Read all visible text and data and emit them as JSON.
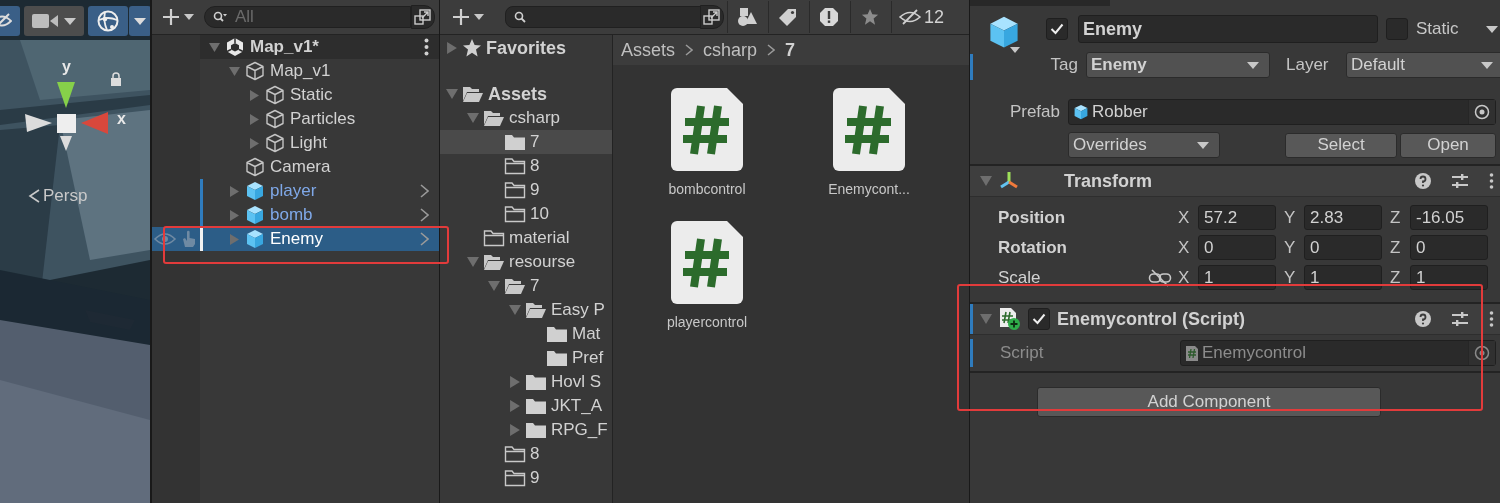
{
  "scene_view": {
    "toolbar": [
      {
        "kind": "visibility",
        "on": true
      },
      {
        "kind": "camera",
        "on": false
      },
      {
        "kind": "gizmos",
        "on": true
      }
    ],
    "gizmo": {
      "axis_labels": [
        "y",
        "x"
      ]
    },
    "projection": "Persp"
  },
  "hierarchy": {
    "search": {
      "placeholder": "All"
    },
    "items": [
      {
        "label": "Map_v1*",
        "kind": "scene",
        "expanded": true,
        "selected": false,
        "hovered": false,
        "highlighted": false,
        "children": [
          {
            "label": "Map_v1",
            "kind": "object",
            "expanded": true,
            "selected": false,
            "hovered": false,
            "highlighted": false,
            "children": [
              {
                "label": "Static",
                "kind": "object",
                "expanded": false,
                "selected": false,
                "hovered": false,
                "highlighted": false
              },
              {
                "label": "Particles",
                "kind": "object",
                "expanded": false,
                "selected": false,
                "hovered": false,
                "highlighted": false
              },
              {
                "label": "Light",
                "kind": "object",
                "expanded": false,
                "selected": false,
                "hovered": false,
                "highlighted": false
              }
            ]
          },
          {
            "label": "Camera",
            "kind": "object",
            "selected": false,
            "hovered": false,
            "highlighted": false
          },
          {
            "label": "player",
            "kind": "prefab",
            "expanded": false,
            "selected": false,
            "hovered": false,
            "highlighted": false
          },
          {
            "label": "bomb",
            "kind": "prefab",
            "expanded": false,
            "selected": false,
            "hovered": false,
            "highlighted": false
          },
          {
            "label": "Enemy",
            "kind": "prefab",
            "expanded": false,
            "selected": true,
            "hovered": true,
            "highlighted": true
          }
        ]
      }
    ]
  },
  "project": {
    "hidden_count": "12",
    "tree": [
      {
        "label": "Favorites",
        "kind": "favorites",
        "expanded": false,
        "selected": false
      },
      {
        "label": "Assets",
        "kind": "folder",
        "expanded": true,
        "selected": false,
        "children": [
          {
            "label": "csharp",
            "kind": "folder",
            "expanded": true,
            "selected": false,
            "children": [
              {
                "label": "7",
                "kind": "folder",
                "empty": false,
                "selected": true
              },
              {
                "label": "8",
                "kind": "folder",
                "empty": true,
                "selected": false
              },
              {
                "label": "9",
                "kind": "folder",
                "empty": true,
                "selected": false
              },
              {
                "label": "10",
                "kind": "folder",
                "empty": true,
                "selected": false
              }
            ]
          },
          {
            "label": "material",
            "kind": "folder",
            "empty": true,
            "selected": false
          },
          {
            "label": "resourse",
            "kind": "folder",
            "expanded": true,
            "selected": false,
            "children": [
              {
                "label": "7",
                "kind": "folder",
                "expanded": true,
                "selected": false,
                "children": [
                  {
                    "label": "Easy P",
                    "kind": "folder",
                    "expanded": true,
                    "selected": false,
                    "children": [
                      {
                        "label": "Mat",
                        "kind": "folder",
                        "empty": false,
                        "selected": false
                      },
                      {
                        "label": "Pref",
                        "kind": "folder",
                        "empty": false,
                        "selected": false
                      }
                    ]
                  },
                  {
                    "label": "Hovl S",
                    "kind": "folder",
                    "expanded": false,
                    "selected": false
                  },
                  {
                    "label": "JKT_A",
                    "kind": "folder",
                    "expanded": false,
                    "selected": false
                  },
                  {
                    "label": "RPG_F",
                    "kind": "folder",
                    "expanded": false,
                    "selected": false
                  }
                ]
              },
              {
                "label": "8",
                "kind": "folder",
                "empty": true,
                "selected": false
              },
              {
                "label": "9",
                "kind": "folder",
                "empty": true,
                "selected": false
              }
            ]
          }
        ]
      }
    ],
    "breadcrumb": [
      "Assets",
      "csharp",
      "7"
    ],
    "files": [
      {
        "name": "bombcontrol",
        "kind": "script"
      },
      {
        "name": "Enemycont...",
        "kind": "script"
      },
      {
        "name": "playercontrol",
        "kind": "script"
      }
    ]
  },
  "inspector": {
    "object": {
      "active": true,
      "name": "Enemy",
      "static": false,
      "static_label": "Static"
    },
    "tag": {
      "label": "Tag",
      "value": "Enemy"
    },
    "layer": {
      "label": "Layer",
      "value": "Default"
    },
    "prefab": {
      "label": "Prefab",
      "asset": "Robber",
      "overrides": "Overrides",
      "buttons": [
        "Select",
        "Open"
      ]
    },
    "components": [
      {
        "kind": "transform",
        "title": "Transform",
        "expanded": true,
        "added": false,
        "highlighted": false,
        "rows": [
          {
            "label": "Position",
            "overridden": true,
            "values": [
              {
                "axis": "X",
                "value": "57.2"
              },
              {
                "axis": "Y",
                "value": "2.83"
              },
              {
                "axis": "Z",
                "value": "-16.05"
              }
            ]
          },
          {
            "label": "Rotation",
            "overridden": true,
            "values": [
              {
                "axis": "X",
                "value": "0"
              },
              {
                "axis": "Y",
                "value": "0"
              },
              {
                "axis": "Z",
                "value": "0"
              }
            ]
          },
          {
            "label": "Scale",
            "overridden": false,
            "constrained": false,
            "values": [
              {
                "axis": "X",
                "value": "1"
              },
              {
                "axis": "Y",
                "value": "1"
              },
              {
                "axis": "Z",
                "value": "1"
              }
            ]
          }
        ]
      },
      {
        "kind": "script",
        "title": "Enemycontrol (Script)",
        "expanded": true,
        "enabled": true,
        "added": true,
        "highlighted": true,
        "fields": [
          {
            "label": "Script",
            "value": "Enemycontrol",
            "disabled": true
          }
        ]
      }
    ],
    "add_component": "Add Component"
  }
}
